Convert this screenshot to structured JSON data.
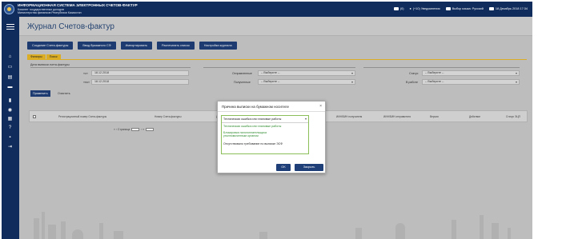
{
  "header": {
    "system_title": "ИНФОРМАЦИОННАЯ СИСТЕМА ЭЛЕКТРОННЫХ СЧЕТОВ-ФАКТУР",
    "subtitle_1": "Комитет государственных доходов",
    "subtitle_2": "Министерства финансов Республики Казахстан",
    "messages": "(0)",
    "notifications": "(+10) Уведомления",
    "language": "Выбор языка: Русский",
    "datetime": "18 Декабрь 2018 17:34"
  },
  "page": {
    "title": "Журнал Счетов-фактур"
  },
  "toolbar": {
    "create_invoice": "Создание Счета-фактуры",
    "import_esf": "Ввод бумажного СФ",
    "import": "Импортировать",
    "print_list": "Распечатать список",
    "journal_settings": "Настройка журнала"
  },
  "tabs": {
    "filters": "Фильтры",
    "search": "Поиск"
  },
  "filters": {
    "date_label": "Дата выписки счета-фактуры",
    "from_label": "«с»",
    "from_value": "18.12.2018",
    "to_label": "«по»",
    "to_value": "18.12.2018",
    "sent_label": "Отправленные",
    "sent_value": "-- Выберите --",
    "received_label": "Полученные",
    "received_value": "-- Выберите --",
    "status_label": "Статус",
    "status_value": "-- Выберите --",
    "in_work_label": "В работе",
    "in_work_value": "-- Выберите --",
    "apply": "Применить",
    "clear": "Очистить"
  },
  "table": {
    "columns": [
      "Регистрационный номер Счета-фактуры",
      "Номер Счета-фактуры",
      "Дата вы...",
      "ИИН/БИН получателя",
      "ИИН/БИН отправителя",
      "Версия",
      "Действие",
      "Статус ЭЦП"
    ]
  },
  "pager": {
    "prefix": "«  ‹  Страница",
    "suffix": "›  »"
  },
  "modal": {
    "title": "Причина выписки на бумажном носителе",
    "selected": "Техническая ошибка или плановые работы",
    "options": [
      "Техническая ошибка или плановые работы",
      "Блокировка налогоплательщика уполномоченным органом",
      "Отсутствовало требование по выписке ЭСФ"
    ],
    "ok": "OK",
    "close": "Закрыть"
  }
}
